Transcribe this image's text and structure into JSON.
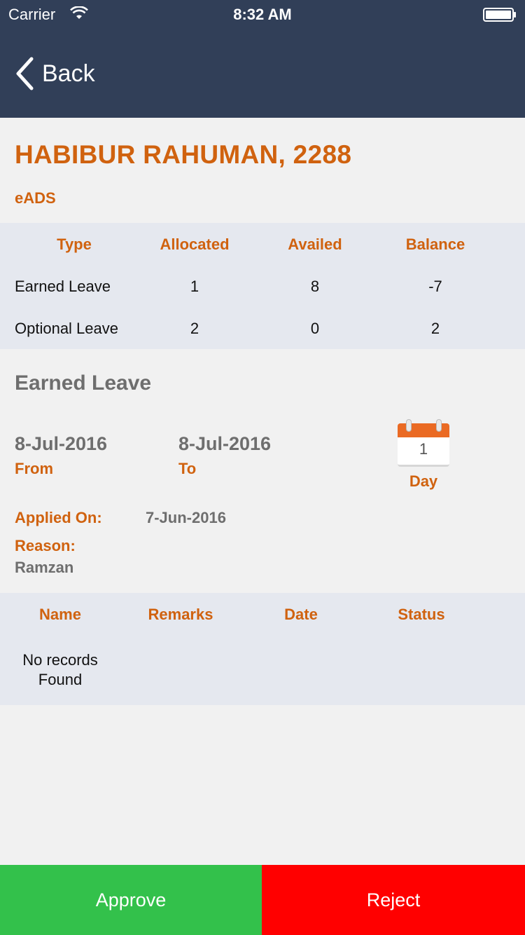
{
  "status_bar": {
    "carrier": "Carrier",
    "time": "8:32 AM"
  },
  "nav": {
    "back_label": "Back"
  },
  "employee": {
    "name": "HABIBUR RAHUMAN, 2288",
    "department": "eADS"
  },
  "balance": {
    "headers": [
      "Type",
      "Allocated",
      "Availed",
      "Balance"
    ],
    "rows": [
      {
        "type": "Earned Leave",
        "allocated": "1",
        "availed": "8",
        "balance": "-7"
      },
      {
        "type": "Optional Leave",
        "allocated": "2",
        "availed": "0",
        "balance": "2"
      }
    ]
  },
  "leave": {
    "title": "Earned Leave",
    "from_value": "8-Jul-2016",
    "from_label": "From",
    "to_value": "8-Jul-2016",
    "to_label": "To",
    "days": "1",
    "day_label": "Day",
    "applied_label": "Applied On:",
    "applied_value": "7-Jun-2016",
    "reason_label": "Reason:",
    "reason_value": "Ramzan"
  },
  "remarks": {
    "headers": [
      "Name",
      "Remarks",
      "Date",
      "Status"
    ],
    "empty_line1": "No records",
    "empty_line2": "Found"
  },
  "actions": {
    "approve": "Approve",
    "reject": "Reject"
  },
  "colors": {
    "navbar": "#313f58",
    "accent": "#d0620f",
    "approve": "#33c14b",
    "reject": "#ff0000"
  }
}
